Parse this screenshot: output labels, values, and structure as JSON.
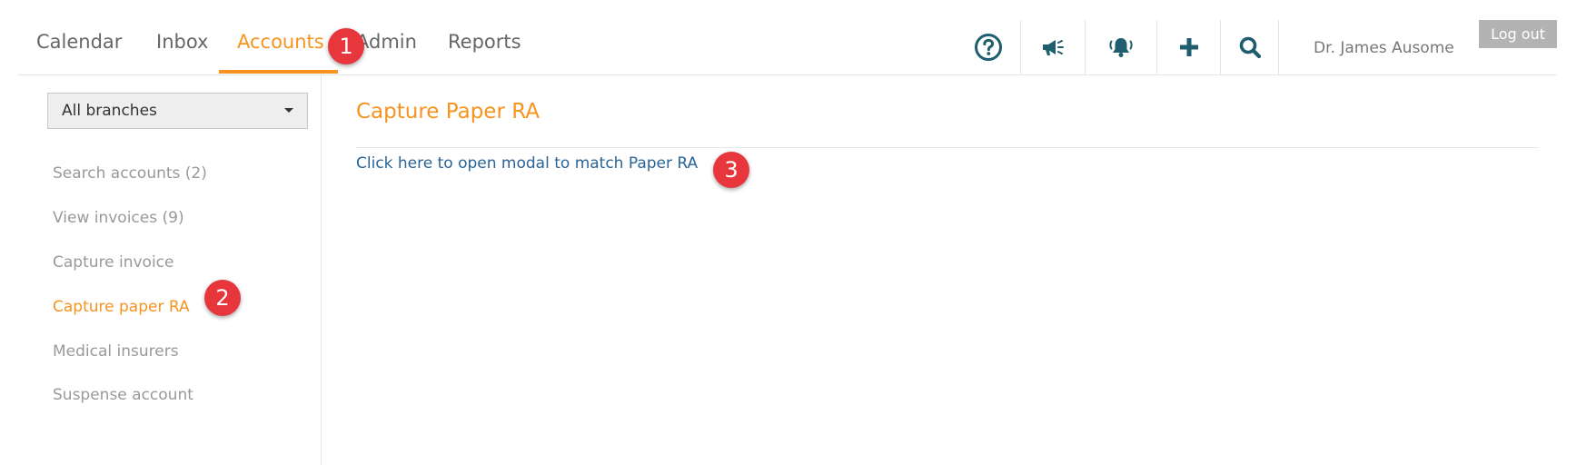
{
  "nav": {
    "tabs": [
      {
        "label": "Calendar"
      },
      {
        "label": "Inbox"
      },
      {
        "label": "Accounts"
      },
      {
        "label": "Admin"
      },
      {
        "label": "Reports"
      }
    ],
    "active_tab": "Accounts"
  },
  "header": {
    "icons": [
      "help-icon",
      "megaphone-icon",
      "bell-icon",
      "plus-icon",
      "search-icon"
    ],
    "user_name": "Dr. James Ausome",
    "logout_label": "Log out"
  },
  "sidebar": {
    "branch_select": "All branches",
    "items": [
      {
        "label": "Search accounts (2)"
      },
      {
        "label": "View invoices (9)"
      },
      {
        "label": "Capture invoice"
      },
      {
        "label": "Capture paper RA"
      },
      {
        "label": "Medical insurers"
      },
      {
        "label": "Suspense account"
      }
    ],
    "active_item": "Capture paper RA"
  },
  "main": {
    "title": "Capture Paper RA",
    "link_text": "Click here to open modal to match Paper RA"
  },
  "callouts": [
    "1",
    "2",
    "3"
  ],
  "colors": {
    "accent": "#f7931e",
    "icon": "#1e5e6e",
    "link": "#2a6496",
    "badge": "#e8373c",
    "muted_text": "#999999"
  }
}
